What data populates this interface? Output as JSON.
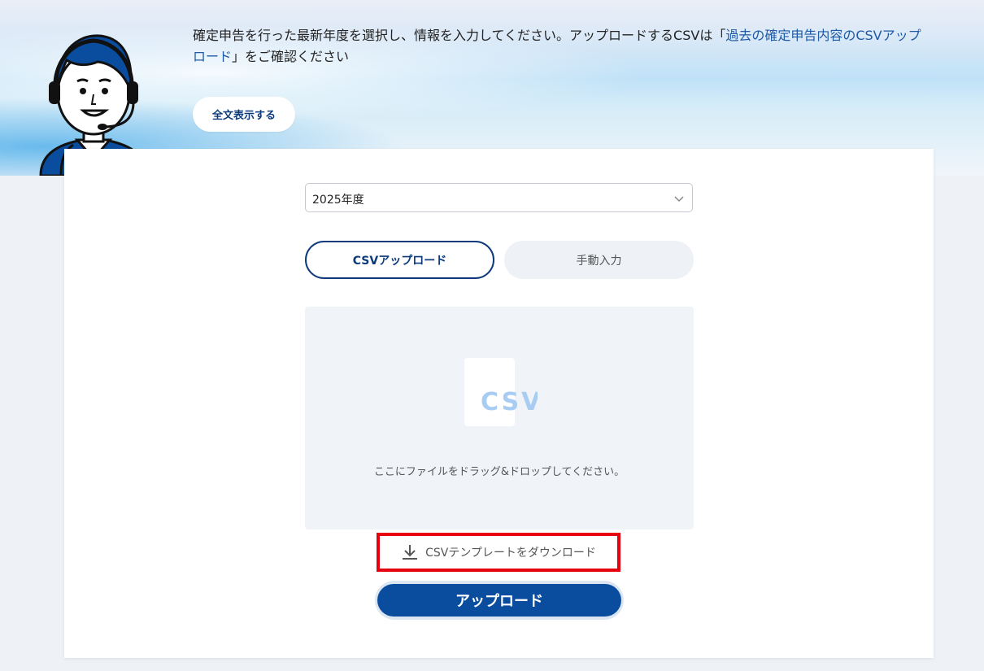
{
  "hero": {
    "text_before_link": "確定申告を行った最新年度を選択し、情報を入力してください。アップロードするCSVは「",
    "link_text": "過去の確定申告内容のCSVアップロード",
    "text_after_link": "」をご確認ください",
    "show_all_label": "全文表示する"
  },
  "form": {
    "year_select": {
      "value": "2025年度",
      "icon": "chevron-down-icon"
    },
    "tabs": [
      {
        "label": "CSVアップロード",
        "active": true
      },
      {
        "label": "手動入力",
        "active": false
      }
    ],
    "dropzone": {
      "icon_text": "CSV",
      "instruction": "ここにファイルをドラッグ&ドロップしてください。"
    },
    "template_download": {
      "label": "CSVテンプレートをダウンロード",
      "icon": "download-icon",
      "highlight_color": "#e6000f"
    },
    "upload_label": "アップロード"
  },
  "colors": {
    "primary": "#0a4d9e",
    "primary_dark": "#0c3a7a",
    "link": "#1f5aa6",
    "page_bg": "#eef1f5",
    "dropzone_bg": "#f0f3f8",
    "csv_icon_text": "#a9cdf2"
  }
}
